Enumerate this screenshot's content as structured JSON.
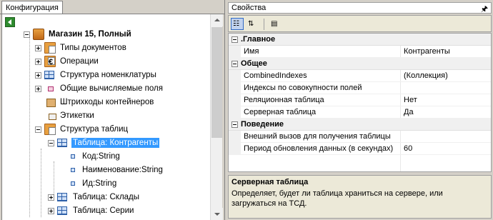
{
  "left": {
    "tab_label": "Конфигурация",
    "tree": [
      {
        "label": "Магазин 15, Полный",
        "bold": true,
        "icon": "shop-icon"
      },
      {
        "label": "Типы документов",
        "icon": "folder-icon"
      },
      {
        "label": "Операции",
        "icon": "operations-icon"
      },
      {
        "label": "Структура номенклатуры",
        "icon": "table-icon"
      },
      {
        "label": "Общие вычисляемые поля",
        "icon": "calc-field-icon"
      },
      {
        "label": "Штрихкоды контейнеров",
        "icon": "container-icon"
      },
      {
        "label": "Этикетки",
        "icon": "label-icon"
      },
      {
        "label": "Структура таблиц",
        "icon": "folder-icon"
      },
      {
        "label": "Таблица: Контрагенты",
        "icon": "table-icon",
        "selected": true
      },
      {
        "label": "Код:String",
        "icon": "field-icon"
      },
      {
        "label": "Наименование:String",
        "icon": "field-icon"
      },
      {
        "label": "Ид:String",
        "icon": "field-icon"
      },
      {
        "label": "Таблица: Склады",
        "icon": "table-icon"
      },
      {
        "label": "Таблица: Серии",
        "icon": "table-icon"
      }
    ]
  },
  "right": {
    "title": "Свойства",
    "pin_icon": "pin-icon",
    "categories": [
      {
        "name": ".Главное",
        "rows": [
          {
            "name": "Имя",
            "value": "Контрагенты"
          }
        ]
      },
      {
        "name": "Общее",
        "rows": [
          {
            "name": "CombinedIndexes",
            "value": "(Коллекция)"
          },
          {
            "name": "Индексы по совокупности полей",
            "value": ""
          },
          {
            "name": "Реляционная таблица",
            "value": "Нет"
          },
          {
            "name": "Серверная таблица",
            "value": "Да"
          }
        ]
      },
      {
        "name": "Поведение",
        "rows": [
          {
            "name": "Внешний вызов для получения таблицы",
            "value": ""
          },
          {
            "name": "Период обновления данных (в секундах)",
            "value": "60"
          }
        ]
      }
    ],
    "description": {
      "title": "Серверная таблица",
      "text": "Определяет, будет ли таблица храниться на сервере, или загружаться на ТСД."
    }
  }
}
